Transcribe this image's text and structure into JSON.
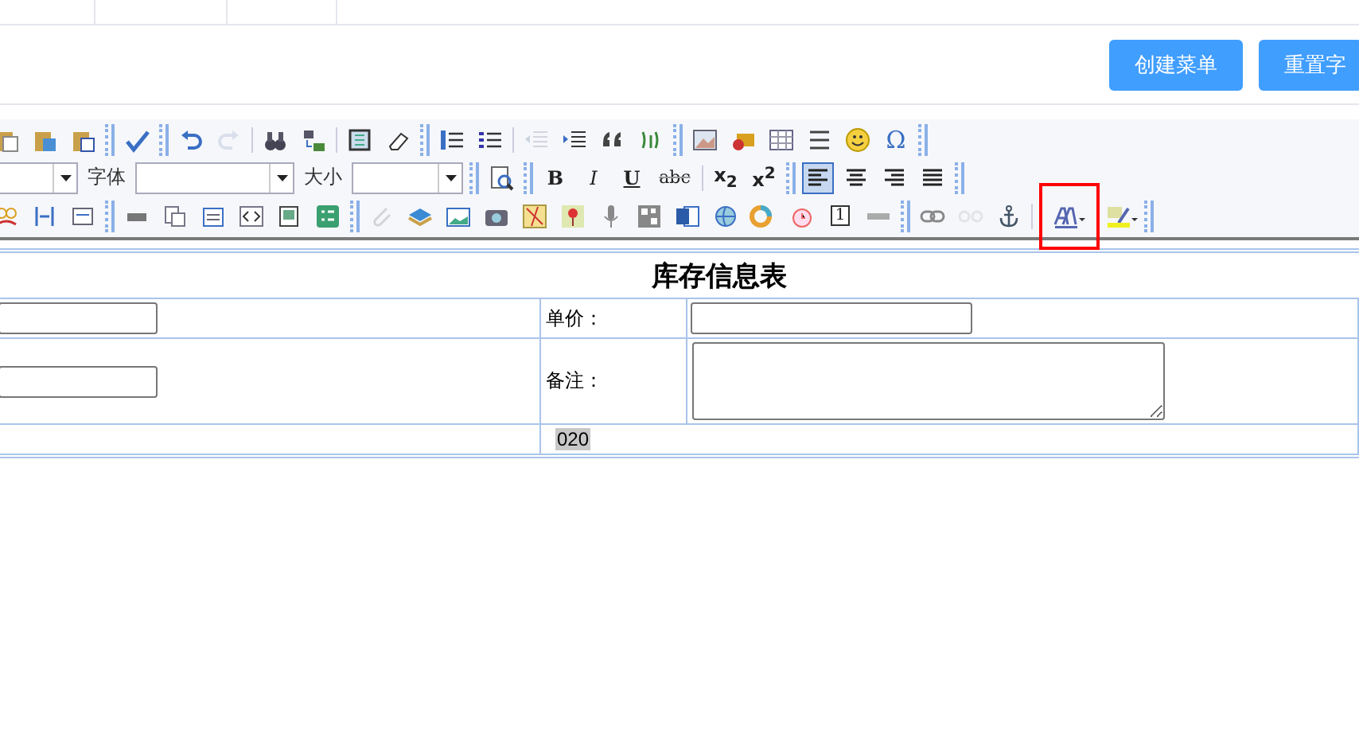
{
  "top_tabs": [
    {
      "selected": false
    },
    {
      "selected": false
    },
    {
      "selected": false
    }
  ],
  "actions": [
    "创建菜单",
    "重置字"
  ],
  "toolbar": {
    "rows": [
      [
        {
          "kind": "icon"
        },
        {
          "kind": "icon"
        },
        {
          "kind": "icon"
        },
        {
          "kind": "bar"
        },
        {
          "kind": "icon"
        },
        {
          "kind": "bar"
        },
        {
          "kind": "icon"
        },
        {
          "kind": "icon",
          "disabled": true
        },
        {
          "kind": "sep"
        },
        {
          "kind": "icon"
        },
        {
          "kind": "icon"
        },
        {
          "kind": "sep"
        },
        {
          "kind": "icon"
        },
        {
          "kind": "icon"
        },
        {
          "kind": "bar"
        },
        {
          "kind": "icon"
        },
        {
          "kind": "icon"
        },
        {
          "kind": "sep"
        },
        {
          "kind": "icon",
          "disabled": true
        },
        {
          "kind": "icon"
        },
        {
          "kind": "icon"
        },
        {
          "kind": "icon"
        },
        {
          "kind": "bar"
        },
        {
          "kind": "icon"
        },
        {
          "kind": "icon"
        },
        {
          "kind": "icon"
        },
        {
          "kind": "icon"
        },
        {
          "kind": "icon"
        },
        {
          "kind": "glyph",
          "text": "Ω"
        },
        {
          "kind": "bar"
        }
      ],
      [
        {
          "kind": "select"
        },
        {
          "kind": "label",
          "text": "字体"
        },
        {
          "kind": "select"
        },
        {
          "kind": "label",
          "text": "大小"
        },
        {
          "kind": "select"
        },
        {
          "kind": "bar"
        },
        {
          "kind": "icon"
        },
        {
          "kind": "bar"
        },
        {
          "kind": "glyph",
          "text": "B"
        },
        {
          "kind": "glyph",
          "text": "I"
        },
        {
          "kind": "glyph",
          "text": "U"
        },
        {
          "kind": "glyph",
          "text": "abc"
        },
        {
          "kind": "sep"
        },
        {
          "kind": "glyph",
          "text": "x$_{2}$"
        },
        {
          "kind": "glyph",
          "text": "x$^{2}$"
        },
        {
          "kind": "bar"
        },
        {
          "kind": "icon",
          "selected": true
        },
        {
          "kind": "icon",
          "selected": false
        },
        {
          "kind": "icon",
          "selected": false
        },
        {
          "kind": "icon",
          "selected": false
        },
        {
          "kind": "bar"
        }
      ],
      [
        {
          "kind": "icon"
        },
        {
          "kind": "icon"
        },
        {
          "kind": "icon"
        },
        {
          "kind": "bar"
        },
        {
          "kind": "icon"
        },
        {
          "kind": "icon"
        },
        {
          "kind": "icon"
        },
        {
          "kind": "icon"
        },
        {
          "kind": "icon"
        },
        {
          "kind": "icon"
        },
        {
          "kind": "bar"
        },
        {
          "kind": "icon",
          "disabled": true
        },
        {
          "kind": "icon"
        },
        {
          "kind": "icon"
        },
        {
          "kind": "icon"
        },
        {
          "kind": "icon"
        },
        {
          "kind": "icon"
        },
        {
          "kind": "icon"
        },
        {
          "kind": "icon"
        },
        {
          "kind": "icon"
        },
        {
          "kind": "icon"
        },
        {
          "kind": "icon"
        },
        {
          "kind": "icon"
        },
        {
          "kind": "glyph",
          "text": "1"
        },
        {
          "kind": "icon"
        },
        {
          "kind": "bar"
        },
        {
          "kind": "icon"
        },
        {
          "kind": "icon",
          "disabled": true
        },
        {
          "kind": "icon"
        },
        {
          "kind": "sep"
        },
        {
          "kind": "icon",
          "highlighted": true
        },
        {
          "kind": "icon"
        },
        {
          "kind": "bar"
        }
      ]
    ]
  },
  "form": {
    "title": "库存信息表",
    "rows": [
      {
        "label": "单价：",
        "kind": "input"
      },
      {
        "label": "备注：",
        "kind": "textarea"
      },
      {
        "value": "020",
        "kind": "text"
      }
    ]
  }
}
